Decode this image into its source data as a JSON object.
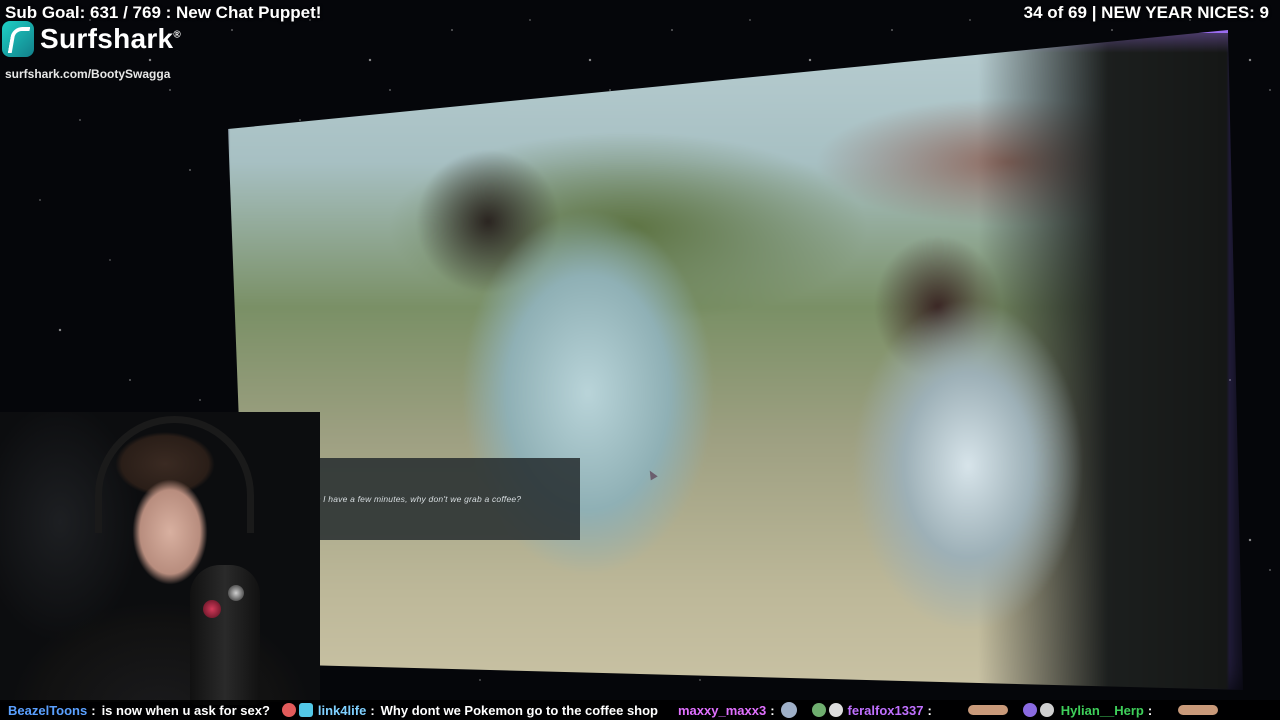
{
  "overlay": {
    "sub_goal": "Sub Goal: 631 / 769 : New Chat Puppet!",
    "counter": "34 of 69 | NEW YEAR NICES: 9",
    "sponsor_brand": "Surfshark",
    "sponsor_mark": "®",
    "sponsor_url": "surfshark.com/BootySwagga"
  },
  "game": {
    "dialog": "Listen I have a few minutes, why don't we grab a coffee?"
  },
  "chat": [
    {
      "user": "BeazelToons",
      "user_color": "#5aa0ff",
      "sep": ":",
      "text": "is now when u ask for sex?"
    },
    {
      "user": "link4life",
      "user_color": "#7fd0ff",
      "sep": ":",
      "text": "Why dont we Pokemon go to the coffee shop"
    },
    {
      "user": "maxxy_maxx3",
      "user_color": "#e070ff",
      "sep": ":",
      "text": ""
    },
    {
      "user": "feralfox1337",
      "user_color": "#c070ff",
      "sep": ":",
      "text": ""
    },
    {
      "user": "Hylian__Herp",
      "user_color": "#3ecf5a",
      "sep": ":",
      "text": ""
    }
  ]
}
